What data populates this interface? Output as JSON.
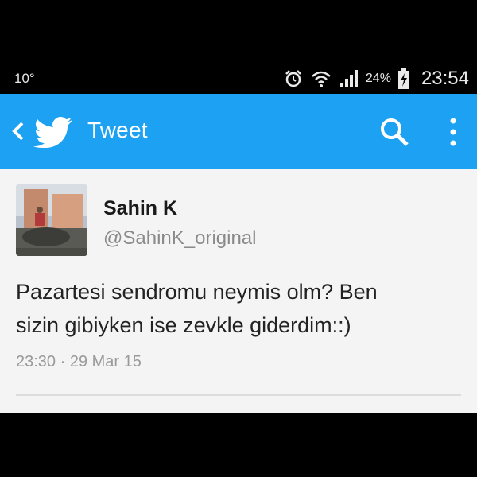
{
  "status_bar": {
    "left_text": "10°",
    "battery_percent": "24%",
    "time": "23:54",
    "icons": [
      "alarm-icon",
      "wifi-icon",
      "signal-icon",
      "battery-charging-icon"
    ]
  },
  "app_bar": {
    "title": "Tweet",
    "color": "#1da1f2",
    "icons": [
      "back-icon",
      "twitter-bird-icon",
      "search-icon",
      "overflow-menu-icon"
    ]
  },
  "tweet": {
    "author_name": "Sahin K",
    "author_handle": "@SahinK_original",
    "text_lines": [
      "Pazartesi sendromu neymis olm? Ben",
      "sizin gibiyken ise zevkle giderdim::)"
    ],
    "timestamp": "23:30 · 29 Mar 15"
  }
}
